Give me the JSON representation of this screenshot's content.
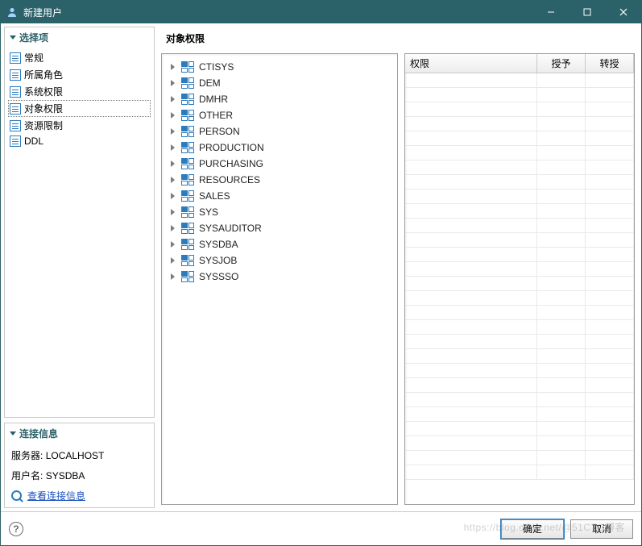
{
  "titlebar": {
    "title": "新建用户"
  },
  "sidebar": {
    "options_title": "选择项",
    "connection_title": "连接信息",
    "nav_items": [
      {
        "label": "常规",
        "selected": false
      },
      {
        "label": "所属角色",
        "selected": false
      },
      {
        "label": "系统权限",
        "selected": false
      },
      {
        "label": "对象权限",
        "selected": true
      },
      {
        "label": "资源限制",
        "selected": false
      },
      {
        "label": "DDL",
        "selected": false
      }
    ]
  },
  "connection": {
    "server_label": "服务器:",
    "server_value": "LOCALHOST",
    "user_label": "用户名:",
    "user_value": "SYSDBA",
    "link_label": "查看连接信息"
  },
  "main": {
    "title": "对象权限",
    "tree_items": [
      "CTISYS",
      "DEM",
      "DMHR",
      "OTHER",
      "PERSON",
      "PRODUCTION",
      "PURCHASING",
      "RESOURCES",
      "SALES",
      "SYS",
      "SYSAUDITOR",
      "SYSDBA",
      "SYSJOB",
      "SYSSSO"
    ]
  },
  "grid": {
    "columns": [
      "权限",
      "授予",
      "转授"
    ],
    "empty_rows": 28
  },
  "footer": {
    "ok": "确定",
    "cancel": "取消"
  },
  "watermark": "https://blog.csdn.net/@51CTO博客"
}
